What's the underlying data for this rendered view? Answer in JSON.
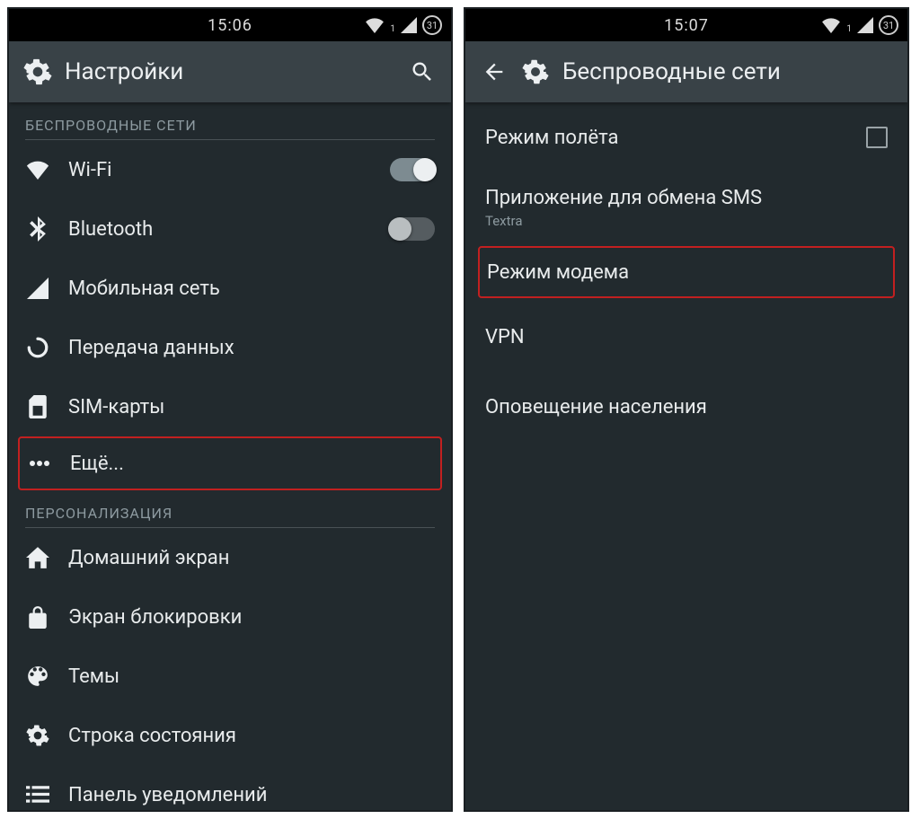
{
  "left": {
    "status": {
      "time": "15:06",
      "sim": "1",
      "badge": "31"
    },
    "appbar": {
      "title": "Настройки"
    },
    "sections": {
      "wireless_header": "БЕСПРОВОДНЫЕ СЕТИ",
      "personalization_header": "ПЕРСОНАЛИЗАЦИЯ"
    },
    "items": {
      "wifi": "Wi-Fi",
      "bluetooth": "Bluetooth",
      "mobile_network": "Мобильная сеть",
      "data_usage": "Передача данных",
      "sim_cards": "SIM-карты",
      "more": "Ещё...",
      "home_screen": "Домашний экран",
      "lock_screen": "Экран блокировки",
      "themes": "Темы",
      "status_bar": "Строка состояния",
      "notification_panel": "Панель уведомлений"
    }
  },
  "right": {
    "status": {
      "time": "15:07",
      "sim": "1",
      "badge": "31"
    },
    "appbar": {
      "title": "Беспроводные сети"
    },
    "items": {
      "airplane": "Режим полёта",
      "sms_app": "Приложение для обмена SMS",
      "sms_app_sub": "Textra",
      "tethering": "Режим модема",
      "vpn": "VPN",
      "cell_broadcast": "Оповещение населения"
    }
  }
}
